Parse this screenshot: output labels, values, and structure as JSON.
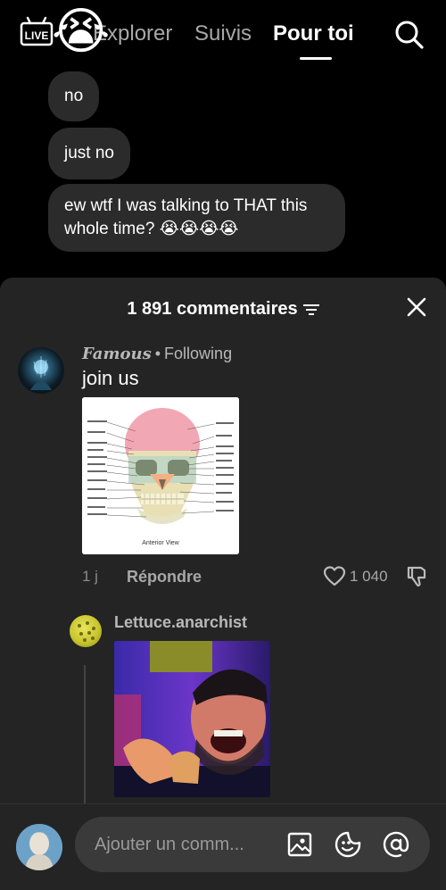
{
  "header": {
    "live_label": "LIVE",
    "emoji": "😭",
    "tabs": [
      {
        "label": "Explorer"
      },
      {
        "label": "Suivis"
      },
      {
        "label": "Pour toi"
      }
    ]
  },
  "chat_bubbles": [
    {
      "text": "no"
    },
    {
      "text": "just no"
    },
    {
      "text": "ew wtf I was talking to THAT this whole time? 😭😭😭😭"
    }
  ],
  "sheet": {
    "title": "1 891 commentaires"
  },
  "comments": [
    {
      "author": "Famous",
      "relation": "Following",
      "text": "join us",
      "image_caption": "Anterior View",
      "time": "1 j",
      "reply_label": "Répondre",
      "likes": "1 040"
    },
    {
      "author": "Lettuce.anarchist"
    }
  ],
  "composer": {
    "placeholder": "Ajouter un comm..."
  }
}
